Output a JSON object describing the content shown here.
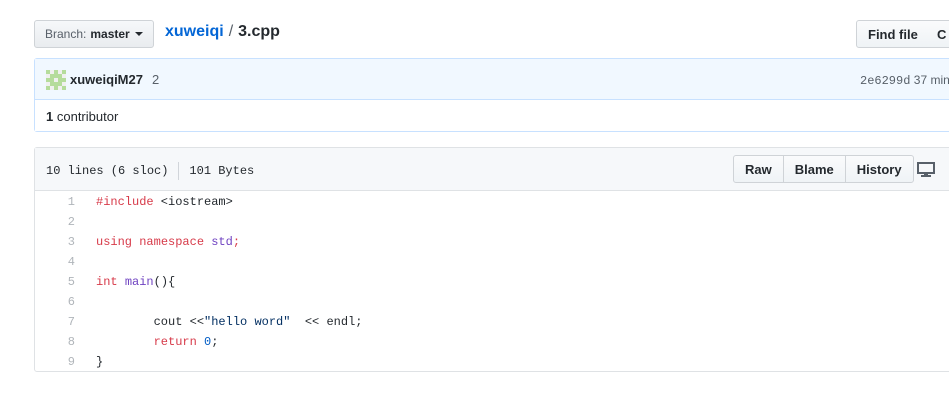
{
  "branch": {
    "label": "Branch:",
    "value": "master"
  },
  "breadcrumb": {
    "repo": "xuweiqi",
    "separator": "/",
    "file": "3.cpp"
  },
  "actions": {
    "find_file": "Find file",
    "copy_path": "C"
  },
  "commit": {
    "author": "xuweiqiM27",
    "message": "2",
    "sha": "2e6299d",
    "time": "37 min"
  },
  "contributors": {
    "count": "1",
    "label": "contributor"
  },
  "file": {
    "lines": "10 lines (6 sloc)",
    "size": "101 Bytes",
    "buttons": {
      "raw": "Raw",
      "blame": "Blame",
      "history": "History"
    },
    "icons": {
      "desktop": "desktop-icon"
    },
    "code": [
      {
        "num": "1",
        "tokens": [
          [
            "pl-k",
            "#include"
          ],
          [
            "",
            " <iostream>"
          ]
        ]
      },
      {
        "num": "2",
        "tokens": []
      },
      {
        "num": "3",
        "tokens": [
          [
            "pl-k",
            "using"
          ],
          [
            "",
            " "
          ],
          [
            "pl-k",
            "namespace"
          ],
          [
            "",
            " "
          ],
          [
            "pl-en",
            "std"
          ],
          [
            "pl-k",
            ";"
          ]
        ]
      },
      {
        "num": "4",
        "tokens": []
      },
      {
        "num": "5",
        "tokens": [
          [
            "pl-k",
            "int"
          ],
          [
            "",
            " "
          ],
          [
            "pl-en",
            "main"
          ],
          [
            "",
            "(){"
          ]
        ]
      },
      {
        "num": "6",
        "tokens": []
      },
      {
        "num": "7",
        "tokens": [
          [
            "",
            "\tcout <<"
          ],
          [
            "pl-s",
            "\"hello word\""
          ],
          [
            "",
            "  << endl;"
          ]
        ]
      },
      {
        "num": "8",
        "tokens": [
          [
            "",
            "\t"
          ],
          [
            "pl-k",
            "return"
          ],
          [
            "",
            " "
          ],
          [
            "pl-c1",
            "0"
          ],
          [
            "",
            ";"
          ]
        ]
      },
      {
        "num": "9",
        "tokens": [
          [
            "",
            "}"
          ]
        ]
      }
    ]
  },
  "colors": {
    "link": "#0366d6",
    "keyword": "#d73a49",
    "entity": "#6f42c1",
    "constant": "#005cc5",
    "string": "#032f62",
    "commit_bg": "#f1f8ff"
  }
}
